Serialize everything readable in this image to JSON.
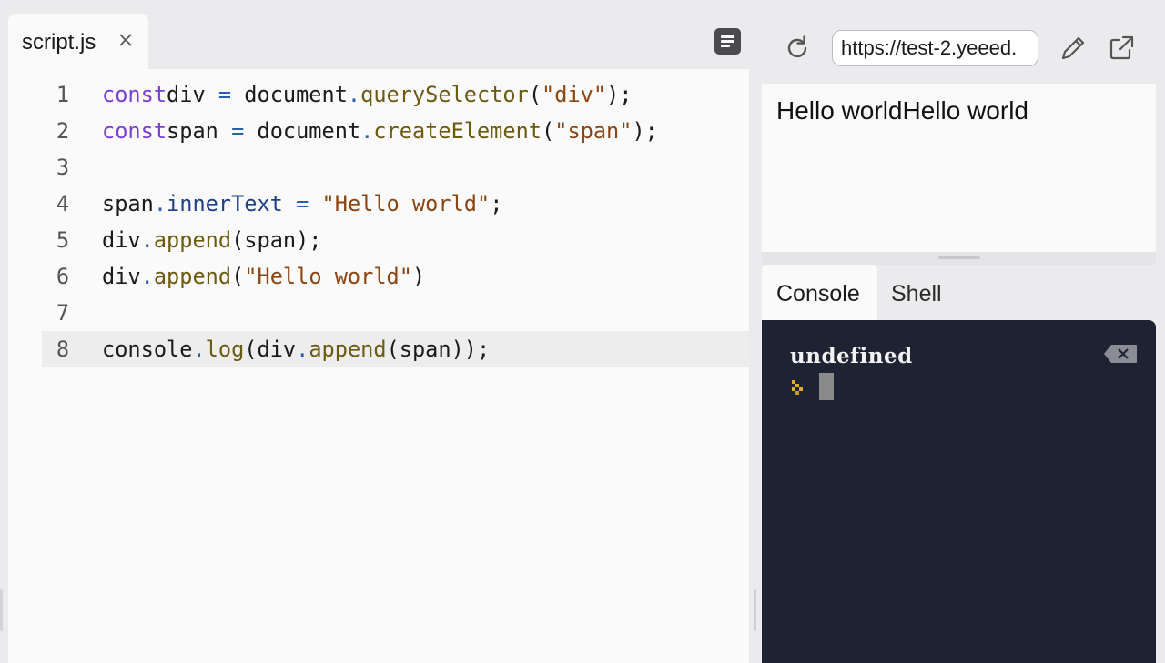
{
  "editor": {
    "tab": {
      "label": "script.js"
    },
    "lines": [
      {
        "n": "1",
        "tokens": [
          [
            "kw",
            "const"
          ],
          [
            "",
            "div "
          ],
          [
            "op",
            "="
          ],
          [
            "",
            " document"
          ],
          [
            "op",
            "."
          ],
          [
            "fn",
            "querySelector"
          ],
          [
            "",
            "("
          ],
          [
            "str",
            "\"div\""
          ],
          [
            "",
            ");"
          ]
        ]
      },
      {
        "n": "2",
        "tokens": [
          [
            "kw",
            "const"
          ],
          [
            "",
            "span "
          ],
          [
            "op",
            "="
          ],
          [
            "",
            " document"
          ],
          [
            "op",
            "."
          ],
          [
            "fn",
            "createElement"
          ],
          [
            "",
            "("
          ],
          [
            "str",
            "\"span\""
          ],
          [
            "",
            ");"
          ]
        ]
      },
      {
        "n": "3",
        "tokens": []
      },
      {
        "n": "4",
        "tokens": [
          [
            "",
            "span"
          ],
          [
            "op",
            "."
          ],
          [
            "prop",
            "innerText"
          ],
          [
            "",
            " "
          ],
          [
            "op",
            "="
          ],
          [
            "",
            " "
          ],
          [
            "str",
            "\"Hello world\""
          ],
          [
            "",
            ";"
          ]
        ]
      },
      {
        "n": "5",
        "tokens": [
          [
            "",
            "div"
          ],
          [
            "op",
            "."
          ],
          [
            "fn",
            "append"
          ],
          [
            "",
            "(span);"
          ]
        ]
      },
      {
        "n": "6",
        "tokens": [
          [
            "",
            "div"
          ],
          [
            "op",
            "."
          ],
          [
            "fn",
            "append"
          ],
          [
            "",
            "("
          ],
          [
            "str",
            "\"Hello world\""
          ],
          [
            "",
            ")"
          ]
        ]
      },
      {
        "n": "7",
        "tokens": []
      },
      {
        "n": "8",
        "tokens": [
          [
            "",
            "console"
          ],
          [
            "op",
            "."
          ],
          [
            "fn",
            "log"
          ],
          [
            "",
            "(div"
          ],
          [
            "op",
            "."
          ],
          [
            "fn",
            "append"
          ],
          [
            "",
            "(span));"
          ]
        ],
        "active": true
      }
    ]
  },
  "preview": {
    "url": "https://test-2.yeeed.",
    "content": "Hello worldHello world"
  },
  "console": {
    "tabs": [
      "Console",
      "Shell"
    ],
    "active_tab": "Console",
    "output": "undefined"
  },
  "colors": {
    "keyword": "#7a3dd8",
    "function": "#6b5a10",
    "string": "#8a4512",
    "console_bg": "#1e2333",
    "prompt": "#e0b020"
  },
  "icons": [
    "close-icon",
    "format-icon",
    "reload-icon",
    "edit-icon",
    "open-external-icon",
    "prompt-icon",
    "clear-console-icon"
  ]
}
